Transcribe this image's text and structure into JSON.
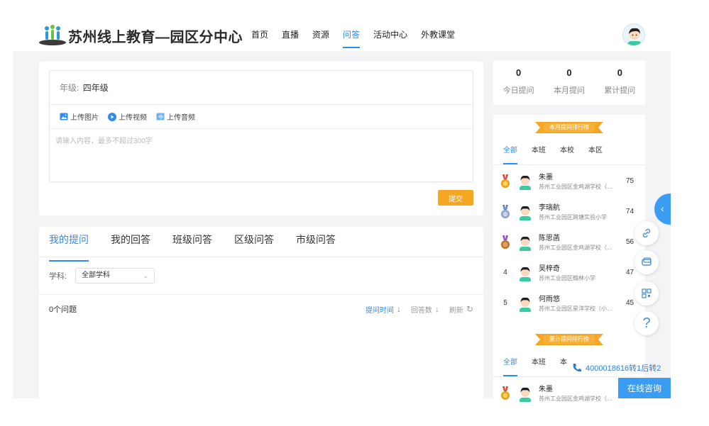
{
  "header": {
    "site_title": "苏州线上教育—园区分中心",
    "nav": [
      {
        "label": "首页",
        "active": false
      },
      {
        "label": "直播",
        "active": false
      },
      {
        "label": "资源",
        "active": false
      },
      {
        "label": "问答",
        "active": true
      },
      {
        "label": "活动中心",
        "active": false
      },
      {
        "label": "外教课堂",
        "active": false
      }
    ],
    "user_avatar_icon": "user-avatar-icon"
  },
  "ask": {
    "grade_label": "年级:",
    "grade_value": "四年级",
    "upload_image": "上传图片",
    "upload_video": "上传视频",
    "upload_audio": "上传音频",
    "input_value": "",
    "input_placeholder": "请输入内容，最多不超过300字",
    "submit_label": "提交"
  },
  "questions": {
    "tabs": [
      "我的提问",
      "我的回答",
      "班级问答",
      "区级问答",
      "市级问答"
    ],
    "active_tab": 0,
    "subject_label": "学科:",
    "subject_value": "全部学科",
    "count_text": "0个问题",
    "sort_time": "提问时间",
    "sort_answers": "回答数",
    "refresh": "刷新"
  },
  "stats": [
    {
      "value": "0",
      "label": "今日提问"
    },
    {
      "value": "0",
      "label": "本月提问"
    },
    {
      "value": "0",
      "label": "累计提问"
    }
  ],
  "monthly_rank": {
    "title": "本月提问排行榜",
    "tabs": [
      "全部",
      "本班",
      "本校",
      "本区"
    ],
    "active_tab": 0,
    "rows": [
      {
        "rank": "1",
        "name": "朱墨",
        "school": "苏州工业园区金鸡湖学校（…",
        "score": "75"
      },
      {
        "rank": "2",
        "name": "李瑞航",
        "school": "苏州工业园区跨塘实验小学",
        "score": "74"
      },
      {
        "rank": "3",
        "name": "陈思菡",
        "school": "苏州工业园区金鸡湖学校（…",
        "score": "56"
      },
      {
        "rank": "4",
        "name": "吴梓奇",
        "school": "苏州工业园区翰林小学",
        "score": "47"
      },
      {
        "rank": "5",
        "name": "何雨悠",
        "school": "苏州工业园区星洋学校（小…",
        "score": "45"
      }
    ]
  },
  "total_rank": {
    "title": "累计提问排行榜",
    "tabs": [
      "全部",
      "本班",
      "本"
    ],
    "active_tab": 0,
    "rows": [
      {
        "rank": "1",
        "name": "朱墨",
        "school": "苏州工业园区金鸡湖学校（…"
      }
    ]
  },
  "widgets": {
    "phone": "4000018616转1后转2",
    "consult_label": "在线咨询"
  },
  "colors": {
    "accent": "#2d8cf0",
    "submit": "#f5a623",
    "ribbon": "#f5a623",
    "float": "#3a9cf3",
    "gold": "#e6a117",
    "silver": "#8fa3c7",
    "bronze": "#c0722f"
  }
}
